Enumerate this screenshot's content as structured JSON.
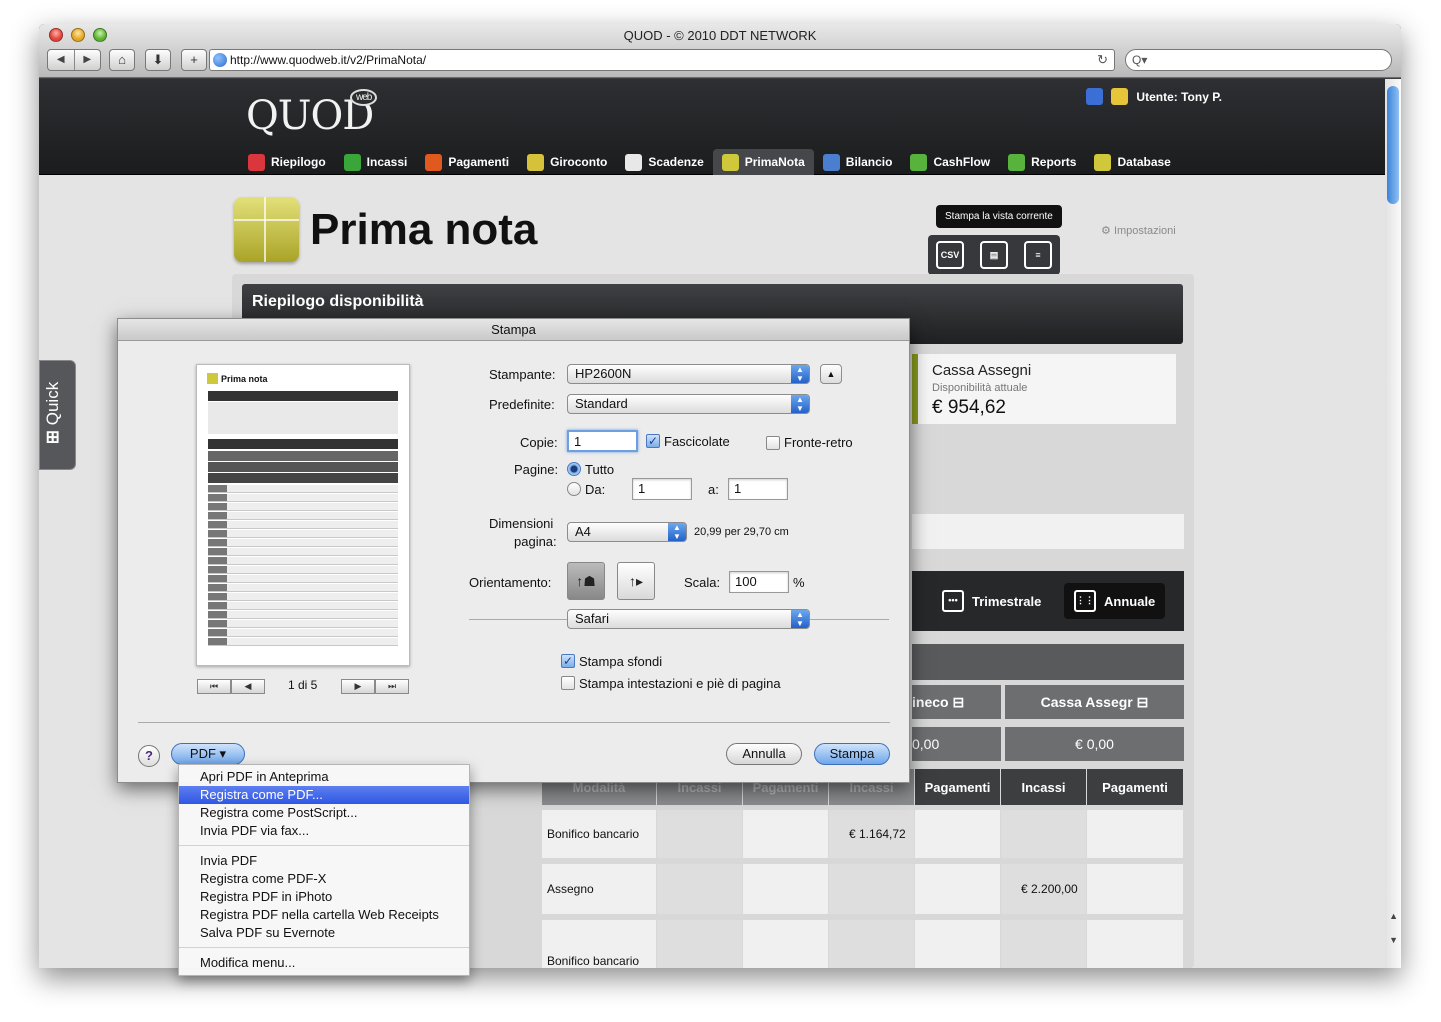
{
  "window": {
    "title": "QUOD - © 2010 DDT NETWORK"
  },
  "browser": {
    "url": "http://www.quodweb.it/v2/PrimaNota/",
    "search_placeholder": "Q▾"
  },
  "header": {
    "logo": "QUOD",
    "logo_badge": "web",
    "user": "Utente: Tony P."
  },
  "nav": [
    {
      "label": "Riepilogo",
      "icon": "summary-icon",
      "color": "#d9363e"
    },
    {
      "label": "Incassi",
      "icon": "plus-icon",
      "color": "#3aa63a"
    },
    {
      "label": "Pagamenti",
      "icon": "minus-icon",
      "color": "#e05a1f"
    },
    {
      "label": "Giroconto",
      "icon": "transfer-icon",
      "color": "#d6c23a"
    },
    {
      "label": "Scadenze",
      "icon": "calendar-icon",
      "color": "#e8e8e8"
    },
    {
      "label": "PrimaNota",
      "icon": "primanota-icon",
      "color": "#cfc83a",
      "active": true
    },
    {
      "label": "Bilancio",
      "icon": "balance-icon",
      "color": "#4a7fcf"
    },
    {
      "label": "CashFlow",
      "icon": "cashflow-icon",
      "color": "#57b33c"
    },
    {
      "label": "Reports",
      "icon": "reports-icon",
      "color": "#57b33c"
    },
    {
      "label": "Database",
      "icon": "database-icon",
      "color": "#cfc83a"
    }
  ],
  "page": {
    "title": "Prima nota",
    "tooltip": "Stampa la vista corrente",
    "export_csv": "CSV",
    "settings": "Impostazioni",
    "quick": "Quick",
    "section_title": "Riepilogo disponibilità",
    "card": {
      "title": "Cassa Assegni",
      "subtitle": "Disponibilità attuale",
      "amount": "€ 954,62"
    },
    "period_buttons": [
      "Trimestrale",
      "Annuale"
    ],
    "columns": [
      "ineco",
      "Cassa Assegr"
    ],
    "totals": [
      "0,00",
      "€ 0,00"
    ],
    "subheaders": [
      "Modalità",
      "Incassi",
      "Pagamenti",
      "Incassi",
      "Pagamenti",
      "Incassi",
      "Pagamenti"
    ],
    "rows": [
      {
        "modalita": "Bonifico bancario",
        "value": "€ 1.164,72"
      },
      {
        "modalita": "Assegno",
        "value": "€ 2.200,00"
      },
      {
        "modalita": "Bonifico bancario",
        "value": ""
      }
    ]
  },
  "print_dialog": {
    "title": "Stampa",
    "preview_title": "Prima nota",
    "page_indicator": "1 di 5",
    "printer_label": "Stampante:",
    "printer": "HP2600N",
    "presets_label": "Predefinite:",
    "presets": "Standard",
    "copies_label": "Copie:",
    "copies": "1",
    "collated": "Fascicolate",
    "duplex": "Fronte-retro",
    "pages_label": "Pagine:",
    "all": "Tutto",
    "from_label": "Da:",
    "from": "1",
    "to_label": "a:",
    "to": "1",
    "size_label_1": "Dimensioni",
    "size_label_2": "pagina:",
    "paper": "A4",
    "paper_dims": "20,99 per 29,70 cm",
    "orientation_label": "Orientamento:",
    "scale_label": "Scala:",
    "scale": "100",
    "scale_unit": "%",
    "app_options": "Safari",
    "print_backgrounds": "Stampa sfondi",
    "print_headers": "Stampa intestazioni e piè di pagina",
    "help": "?",
    "pdf_button": "PDF ▾",
    "cancel": "Annulla",
    "print": "Stampa"
  },
  "pdf_menu": {
    "group1": [
      "Apri PDF in Anteprima",
      "Registra come PDF...",
      "Registra come PostScript...",
      "Invia PDF via fax..."
    ],
    "group2": [
      "Invia PDF",
      "Registra come PDF-X",
      "Registra PDF in iPhoto",
      "Registra PDF nella cartella Web Receipts",
      "Salva PDF su Evernote"
    ],
    "group3": [
      "Modifica menu..."
    ],
    "highlighted": "Registra come PDF..."
  }
}
